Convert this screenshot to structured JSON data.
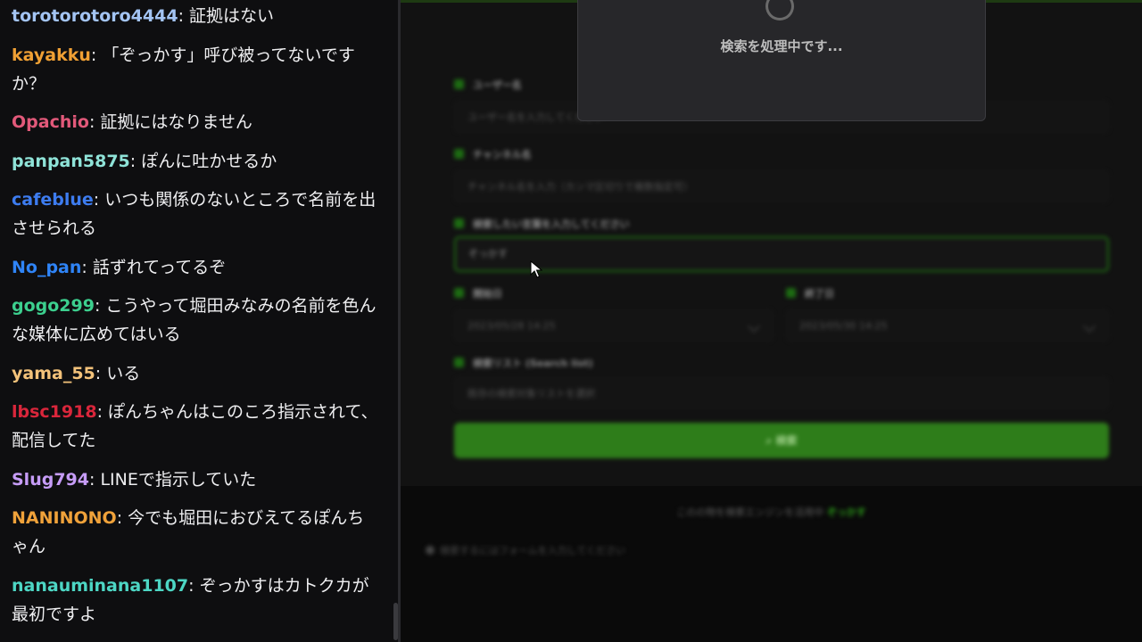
{
  "chat": {
    "messages": [
      {
        "user": "torotorotoro4444",
        "color": "#a3c4f3",
        "text": "証拠はない"
      },
      {
        "user": "kayakku",
        "color": "#f0a034",
        "text": "「ぞっかす」呼び被ってないですか？"
      },
      {
        "user": "Opachio",
        "color": "#e2597a",
        "text": "証拠にはなりません"
      },
      {
        "user": "panpan5875",
        "color": "#8fe3d8",
        "text": "ぽんに吐かせるか"
      },
      {
        "user": "cafeblue",
        "color": "#3d7cf0",
        "text": "いつも関係のないところで名前を出させられる"
      },
      {
        "user": "No_pan",
        "color": "#2f84f7",
        "text": "話ずれてってるぞ"
      },
      {
        "user": "gogo299",
        "color": "#3ccf8e",
        "text": "こうやって堀田みなみの名前を色んな媒体に広めてはいる"
      },
      {
        "user": "yama_55",
        "color": "#f3c27a",
        "text": "いる"
      },
      {
        "user": "lbsc1918",
        "color": "#d9263b",
        "text": "ぽんちゃんはこのころ指示されて、配信してた"
      },
      {
        "user": "Slug794",
        "color": "#c69cf7",
        "text": "LINEで指示していた"
      },
      {
        "user": "NANINONO",
        "color": "#f0a23a",
        "text": "今でも堀田におびえてるぽんちゃん"
      },
      {
        "user": "nanauminana1107",
        "color": "#4dd6c4",
        "text": "ぞっかすはカトクカが最初ですよ"
      }
    ]
  },
  "form": {
    "username_label": "ユーザー名",
    "username_placeholder": "ユーザー名を入力してください",
    "channel_label": "チャンネル名",
    "channel_placeholder": "チャンネル名を入力（カンマ区切りで複数指定可）",
    "keyword_label": "検索したい言葉を入力してください",
    "keyword_value": "ぞっかす",
    "start_label": "開始日",
    "start_value": "2023/05/28 14:25",
    "end_label": "終了日",
    "end_value": "2023/05/30 14:25",
    "list_label": "検索リスト (Search list)",
    "list_placeholder": "既存の検索対象リストを選択",
    "search_button": "検索",
    "footer_text": "このの物を検索エンジンを活用中",
    "footer_link": "ぞっかす",
    "footer_tip": "検索するにはフォームを入力してください"
  },
  "loading": {
    "text": "検索を処理中です..."
  }
}
